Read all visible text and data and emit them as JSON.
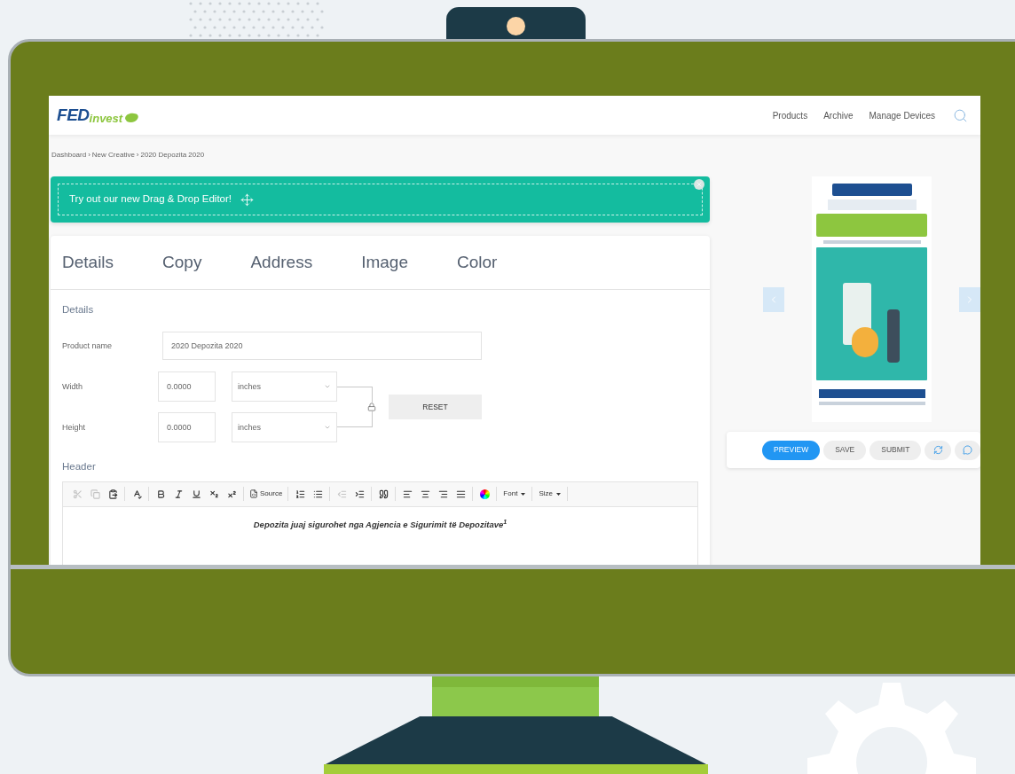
{
  "header": {
    "logo": {
      "strong": "FED",
      "light": "invest"
    },
    "nav": [
      "Products",
      "Archive",
      "Manage Devices"
    ]
  },
  "breadcrumb": {
    "separator": "›",
    "items": [
      "Dashboard",
      "New Creative",
      "2020 Depozita 2020"
    ]
  },
  "banner": {
    "text": "Try out our new Drag & Drop Editor!"
  },
  "tabs": [
    {
      "label": "Details",
      "selected": false
    },
    {
      "label": "Copy",
      "selected": false
    },
    {
      "label": "Address",
      "selected": false
    },
    {
      "label": "Image",
      "selected": false
    },
    {
      "label": "Color",
      "selected": false
    }
  ],
  "details": {
    "heading": "Details",
    "product_name": {
      "label": "Product name",
      "value": "2020 Depozita 2020"
    },
    "width": {
      "label": "Width",
      "value": "0.0000",
      "unit": "inches"
    },
    "height": {
      "label": "Height",
      "value": "0.0000",
      "unit": "inches"
    },
    "reset_button": "RESET"
  },
  "header_section": {
    "heading": "Header",
    "toolbar": [
      {
        "kind": "cut",
        "disabled": true
      },
      {
        "kind": "copy",
        "disabled": true
      },
      {
        "kind": "paste",
        "disabled": false
      },
      {
        "kind": "sep"
      },
      {
        "kind": "spell",
        "disabled": false
      },
      {
        "kind": "sep"
      },
      {
        "kind": "bold",
        "disabled": false
      },
      {
        "kind": "italic",
        "disabled": false
      },
      {
        "kind": "underline",
        "disabled": false
      },
      {
        "kind": "subscript",
        "disabled": false
      },
      {
        "kind": "superscript",
        "disabled": false
      },
      {
        "kind": "sep"
      },
      {
        "kind": "source",
        "label": "Source",
        "disabled": false
      },
      {
        "kind": "sep"
      },
      {
        "kind": "ordered-list",
        "disabled": false
      },
      {
        "kind": "bullet-list",
        "disabled": false
      },
      {
        "kind": "sep"
      },
      {
        "kind": "outdent",
        "disabled": true
      },
      {
        "kind": "indent",
        "disabled": false
      },
      {
        "kind": "sep"
      },
      {
        "kind": "quote",
        "disabled": false
      },
      {
        "kind": "sep"
      },
      {
        "kind": "align-left",
        "disabled": false
      },
      {
        "kind": "align-center",
        "disabled": false
      },
      {
        "kind": "align-right",
        "disabled": false
      },
      {
        "kind": "justify",
        "disabled": false
      },
      {
        "kind": "sep"
      },
      {
        "kind": "color",
        "disabled": false
      },
      {
        "kind": "sep"
      },
      {
        "kind": "dropdown",
        "label": "Font",
        "disabled": false
      },
      {
        "kind": "sep"
      },
      {
        "kind": "dropdown",
        "label": "Size",
        "disabled": false
      },
      {
        "kind": "sep"
      }
    ],
    "content": "Depozita juaj sigurohet nga Agjencia e Sigurimit të Depozitave$^{1}$"
  },
  "actions": [
    {
      "kind": "primary",
      "label": "PREVIEW"
    },
    {
      "kind": "secondary",
      "label": "SAVE"
    },
    {
      "kind": "secondary",
      "label": "SUBMIT"
    },
    {
      "kind": "refresh"
    },
    {
      "kind": "comment"
    }
  ]
}
